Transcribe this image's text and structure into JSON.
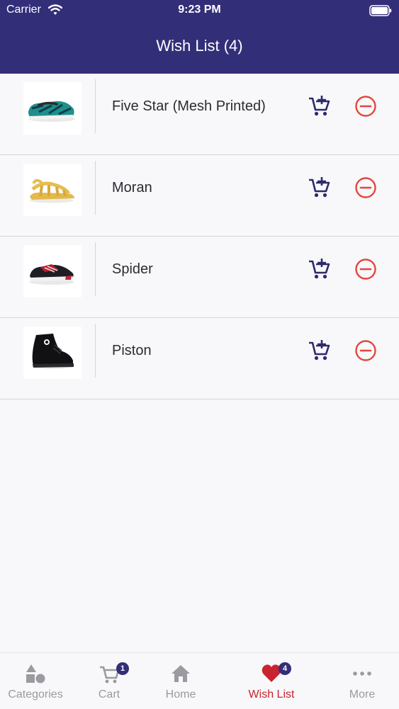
{
  "status_bar": {
    "carrier": "Carrier",
    "time": "9:23 PM"
  },
  "header": {
    "title": "Wish List (4)"
  },
  "wishlist": [
    {
      "name": "Five Star (Mesh Printed)",
      "image": "teal-patterned-slip-on-shoe"
    },
    {
      "name": "Moran",
      "image": "yellow-sandal"
    },
    {
      "name": "Spider",
      "image": "black-red-sneaker"
    },
    {
      "name": "Piston",
      "image": "black-high-top-boot"
    }
  ],
  "actions": {
    "add_to_cart_icon": "cart-add-icon",
    "remove_icon": "remove-circle-icon"
  },
  "tabbar": {
    "tabs": [
      {
        "label": "Categories",
        "icon": "shapes-icon",
        "active": false
      },
      {
        "label": "Cart",
        "icon": "cart-icon",
        "badge": "1",
        "active": false
      },
      {
        "label": "Home",
        "icon": "home-icon",
        "active": false
      },
      {
        "label": "Wish List",
        "icon": "heart-icon",
        "badge": "4",
        "active": true
      },
      {
        "label": "More",
        "icon": "more-dots-icon",
        "active": false
      }
    ]
  },
  "colors": {
    "header_bg": "#332e78",
    "accent_red": "#c8242f",
    "remove_red": "#e2473c",
    "icon_navy": "#2d2a6e",
    "inactive_gray": "#9b9aa0"
  }
}
